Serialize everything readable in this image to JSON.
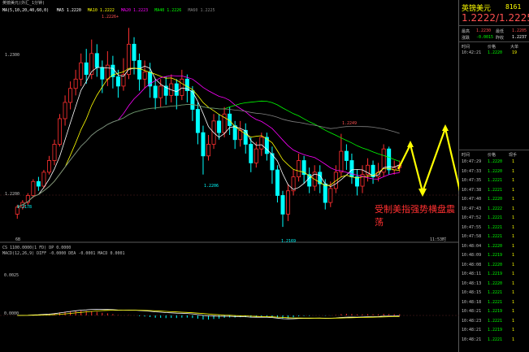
{
  "header": {
    "symbol_label": "英镑美元(外汇_1分钟)",
    "ma_labels": [
      {
        "text": "MA(5,10,20,40,60,0)",
        "color": "#ffffff"
      },
      {
        "text": "MA5 1.2220",
        "color": "#ffffff"
      },
      {
        "text": "MA10 1.2222",
        "color": "#ffff00"
      },
      {
        "text": "MA20 1.2223",
        "color": "#ff00ff"
      },
      {
        "text": "MA40 1.2226",
        "color": "#00ff00"
      },
      {
        "text": "MA60 1.2225",
        "color": "#808080"
      }
    ]
  },
  "price_axis": {
    "top": "1.2300",
    "mid": "1.2200",
    "low": "1.2190"
  },
  "annotations": {
    "high": "1.2226+",
    "peak2": "1.2249",
    "low1": "1.2206",
    "low2": "1.2169",
    "left_low": "1.2178",
    "time_start": "6B",
    "time_end": "11:53时"
  },
  "overlay_text": "受制美指强势横盘震荡",
  "indicator": {
    "vol_label": "CS 1100.0000(1 FD)  DP 0.0000",
    "macd_label": "MACD(12,26,9)  DIFF -0.0000  DEA -0.0001  MACD 0.0001",
    "axis_top": "0.0025",
    "axis_zero": "0.0000"
  },
  "quote": {
    "title": "英镑美元",
    "code": "8161",
    "price": "1.2222/1.2225",
    "rows": [
      {
        "l1": "最高",
        "v1": "1.2230",
        "l2": "最低",
        "v2": "1.2205"
      },
      {
        "l1": "涨跌",
        "v1": "-0.0015",
        "l2": "昨收",
        "v2": "1.2237"
      }
    ],
    "small_head": [
      "时间",
      "价格",
      "大单"
    ],
    "small_row": [
      "10:42:21",
      "1.2220",
      "19"
    ],
    "tick_head": [
      "时间",
      "价格",
      "现手"
    ],
    "ticks": [
      [
        "10:47:29",
        "1.2220",
        "1"
      ],
      [
        "10:47:33",
        "1.2220",
        "1"
      ],
      [
        "10:47:35",
        "1.2221",
        "1"
      ],
      [
        "10:47:38",
        "1.2221",
        "1"
      ],
      [
        "10:47:40",
        "1.2220",
        "1"
      ],
      [
        "10:47:43",
        "1.2222",
        "1"
      ],
      [
        "10:47:52",
        "1.2221",
        "1"
      ],
      [
        "10:47:55",
        "1.2221",
        "1"
      ],
      [
        "10:47:58",
        "1.2221",
        "1"
      ],
      [
        "10:48:04",
        "1.2220",
        "1"
      ],
      [
        "10:48:09",
        "1.2219",
        "1"
      ],
      [
        "10:48:08",
        "1.2220",
        "1"
      ],
      [
        "10:48:11",
        "1.2219",
        "1"
      ],
      [
        "10:48:13",
        "1.2220",
        "1"
      ],
      [
        "10:48:15",
        "1.2221",
        "1"
      ],
      [
        "10:48:18",
        "1.2221",
        "1"
      ],
      [
        "10:48:21",
        "1.2219",
        "1"
      ],
      [
        "10:48:23",
        "1.2221",
        "1"
      ],
      [
        "10:48:21",
        "1.2219",
        "1"
      ],
      [
        "10:48:21",
        "1.2221",
        "1"
      ]
    ]
  },
  "colors": {
    "up": "#ff3030",
    "down": "#00ffff",
    "ma5": "#ffffff",
    "ma10": "#ffff00",
    "ma20": "#ff00ff",
    "ma40": "#00ff00",
    "ma60": "#808080",
    "arrow": "#ffff00"
  },
  "candles": [
    [
      1.218,
      1.2186,
      1.2188,
      1.2176
    ],
    [
      1.2186,
      1.219,
      1.2192,
      1.2184
    ],
    [
      1.219,
      1.2196,
      1.2198,
      1.2188
    ],
    [
      1.2196,
      1.2208,
      1.221,
      1.2194
    ],
    [
      1.2208,
      1.2204,
      1.2212,
      1.22
    ],
    [
      1.2204,
      1.2216,
      1.2218,
      1.2202
    ],
    [
      1.2216,
      1.2226,
      1.223,
      1.2214
    ],
    [
      1.2226,
      1.224,
      1.2244,
      1.2222
    ],
    [
      1.224,
      1.2262,
      1.2266,
      1.2238
    ],
    [
      1.2262,
      1.2276,
      1.2282,
      1.2256
    ],
    [
      1.2276,
      1.2288,
      1.2294,
      1.227
    ],
    [
      1.2288,
      1.2296,
      1.2304,
      1.2282
    ],
    [
      1.2296,
      1.231,
      1.2318,
      1.229
    ],
    [
      1.231,
      1.23,
      1.2322,
      1.2292
    ],
    [
      1.23,
      1.2318,
      1.233,
      1.2296
    ],
    [
      1.2318,
      1.2306,
      1.2326,
      1.2298
    ],
    [
      1.2306,
      1.2296,
      1.2312,
      1.2284
    ],
    [
      1.2296,
      1.2308,
      1.232,
      1.229
    ],
    [
      1.2308,
      1.2298,
      1.2316,
      1.2288
    ],
    [
      1.2298,
      1.229,
      1.2304,
      1.228
    ],
    [
      1.229,
      1.23,
      1.2314,
      1.2286
    ],
    [
      1.23,
      1.2326,
      1.234,
      1.2296
    ],
    [
      1.2326,
      1.2312,
      1.2332,
      1.23
    ],
    [
      1.2312,
      1.2296,
      1.2318,
      1.2286
    ],
    [
      1.2296,
      1.2302,
      1.2312,
      1.2288
    ],
    [
      1.2302,
      1.229,
      1.231,
      1.228
    ],
    [
      1.229,
      1.228,
      1.2296,
      1.227
    ],
    [
      1.228,
      1.229,
      1.2296,
      1.2272
    ],
    [
      1.229,
      1.2282,
      1.2298,
      1.2274
    ],
    [
      1.2282,
      1.2292,
      1.23,
      1.2276
    ],
    [
      1.2292,
      1.2282,
      1.2296,
      1.227
    ],
    [
      1.2282,
      1.2296,
      1.2304,
      1.2278
    ],
    [
      1.2296,
      1.2286,
      1.23,
      1.2276
    ],
    [
      1.2286,
      1.227,
      1.229,
      1.226
    ],
    [
      1.227,
      1.225,
      1.2276,
      1.224
    ],
    [
      1.225,
      1.223,
      1.2256,
      1.2214
    ],
    [
      1.223,
      1.224,
      1.2248,
      1.2226
    ],
    [
      1.224,
      1.226,
      1.2266,
      1.2236
    ],
    [
      1.226,
      1.225,
      1.2266,
      1.2244
    ],
    [
      1.225,
      1.2266,
      1.2272,
      1.2246
    ],
    [
      1.2266,
      1.2256,
      1.2272,
      1.2248
    ],
    [
      1.2256,
      1.2244,
      1.226,
      1.2236
    ],
    [
      1.2244,
      1.2252,
      1.226,
      1.2238
    ],
    [
      1.2252,
      1.224,
      1.2258,
      1.2232
    ],
    [
      1.224,
      1.2224,
      1.2246,
      1.2216
    ],
    [
      1.2224,
      1.2236,
      1.2242,
      1.222
    ],
    [
      1.2236,
      1.2246,
      1.225,
      1.223
    ],
    [
      1.2246,
      1.2232,
      1.225,
      1.2226
    ],
    [
      1.2232,
      1.2218,
      1.2238,
      1.2206
    ],
    [
      1.2218,
      1.2196,
      1.2222,
      1.219
    ],
    [
      1.2196,
      1.218,
      1.22,
      1.2169
    ],
    [
      1.218,
      1.22,
      1.2206,
      1.2174
    ],
    [
      1.22,
      1.2212,
      1.2218,
      1.2196
    ],
    [
      1.2212,
      1.2226,
      1.2232,
      1.2208
    ],
    [
      1.2226,
      1.2214,
      1.223,
      1.2206
    ],
    [
      1.2214,
      1.2204,
      1.222,
      1.2198
    ],
    [
      1.2204,
      1.2216,
      1.2222,
      1.22
    ],
    [
      1.2216,
      1.2206,
      1.2222,
      1.2198
    ],
    [
      1.2206,
      1.219,
      1.221,
      1.2184
    ],
    [
      1.219,
      1.2202,
      1.2208,
      1.2186
    ],
    [
      1.2202,
      1.2216,
      1.2222,
      1.2198
    ],
    [
      1.2216,
      1.2234,
      1.2249,
      1.2212
    ],
    [
      1.2234,
      1.2226,
      1.224,
      1.2218
    ],
    [
      1.2226,
      1.2212,
      1.2232,
      1.2206
    ],
    [
      1.2212,
      1.2204,
      1.2218,
      1.2196
    ],
    [
      1.2204,
      1.2214,
      1.2222,
      1.2198
    ],
    [
      1.2214,
      1.2222,
      1.2228,
      1.2208
    ],
    [
      1.2222,
      1.2212,
      1.2226,
      1.2206
    ],
    [
      1.2212,
      1.2216,
      1.2224,
      1.2208
    ],
    [
      1.2216,
      1.2236,
      1.224,
      1.2212
    ],
    [
      1.2236,
      1.2218,
      1.2238,
      1.2214
    ],
    [
      1.2218,
      1.222,
      1.2226,
      1.2214
    ],
    [
      1.222,
      1.2222,
      1.2226,
      1.2216
    ]
  ]
}
